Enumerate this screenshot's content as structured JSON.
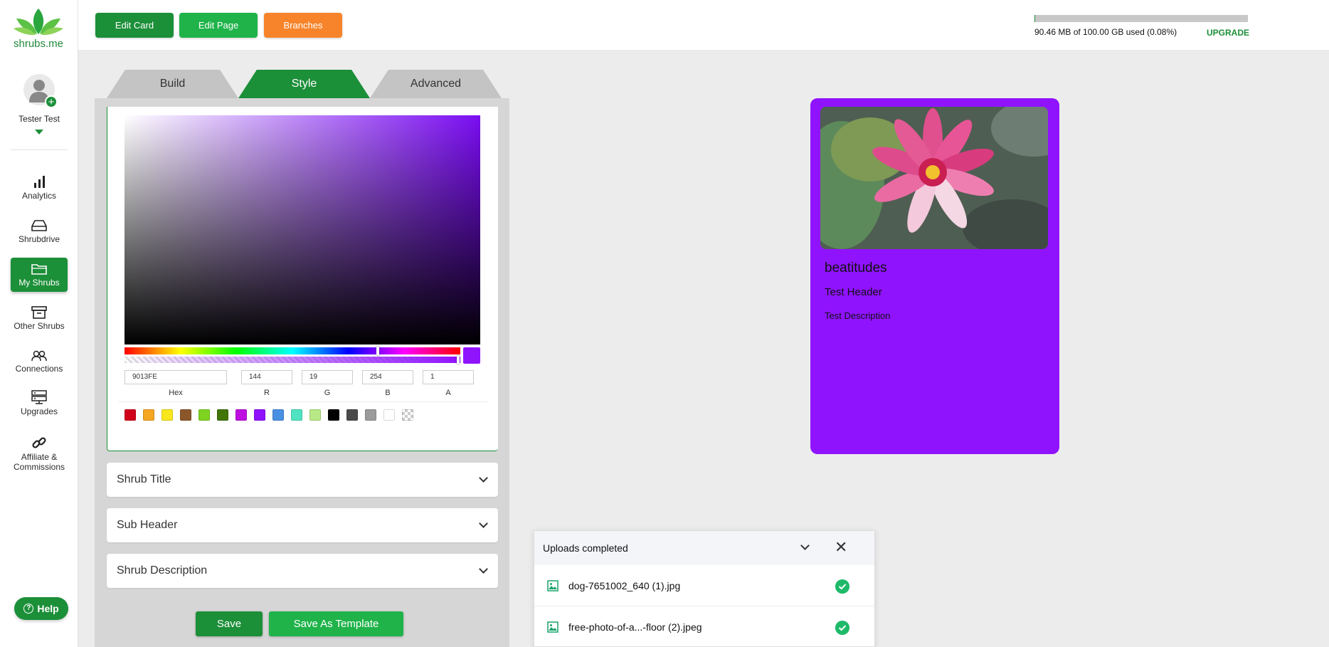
{
  "brand": {
    "name": "shrubs.me"
  },
  "user": {
    "name": "Tester Test"
  },
  "nav": [
    {
      "label": "Analytics"
    },
    {
      "label": "Shrubdrive"
    },
    {
      "label": "My Shrubs"
    },
    {
      "label": "Other Shrubs"
    },
    {
      "label": "Connections"
    },
    {
      "label": "Upgrades"
    },
    {
      "label": "Affiliate & Commissions"
    }
  ],
  "help": {
    "label": "Help"
  },
  "toolbar": {
    "edit_card": "Edit Card",
    "edit_page": "Edit Page",
    "branches": "Branches"
  },
  "storage": {
    "text": "90.46 MB of 100.00 GB used (0.08%)",
    "upgrade": "UPGRADE",
    "used_fraction": 0.0008
  },
  "notifications": {
    "count": "2"
  },
  "tabs": {
    "build": "Build",
    "style": "Style",
    "advanced": "Advanced"
  },
  "picker": {
    "hex": "9013FE",
    "r": "144",
    "g": "19",
    "b": "254",
    "a": "1",
    "labels": {
      "hex": "Hex",
      "r": "R",
      "g": "G",
      "b": "B",
      "a": "A"
    },
    "presets": [
      "#d0021b",
      "#f5a623",
      "#f8e71c",
      "#8b572a",
      "#7ed321",
      "#417505",
      "#bd10e0",
      "#9013fe",
      "#4a90e2",
      "#50e3c2",
      "#b8e986",
      "#000000",
      "#4a4a4a",
      "#9b9b9b",
      "#ffffff",
      "transparent"
    ]
  },
  "sections": {
    "title": "Shrub Title",
    "subheader": "Sub Header",
    "description": "Shrub Description"
  },
  "actions": {
    "save": "Save",
    "save_template": "Save As Template"
  },
  "preview": {
    "title": "beatitudes",
    "header": "Test Header",
    "description": "Test Description",
    "background": "#9013fe"
  },
  "uploads": {
    "title": "Uploads completed",
    "files": [
      {
        "name": "dog-7651002_640 (1).jpg"
      },
      {
        "name": "free-photo-of-a...-floor (2).jpeg"
      }
    ]
  },
  "colors": {
    "accent": "#1c8f39",
    "accent_light": "#1fb34a",
    "branches": "#f7842a",
    "selected": "#9013fe"
  }
}
